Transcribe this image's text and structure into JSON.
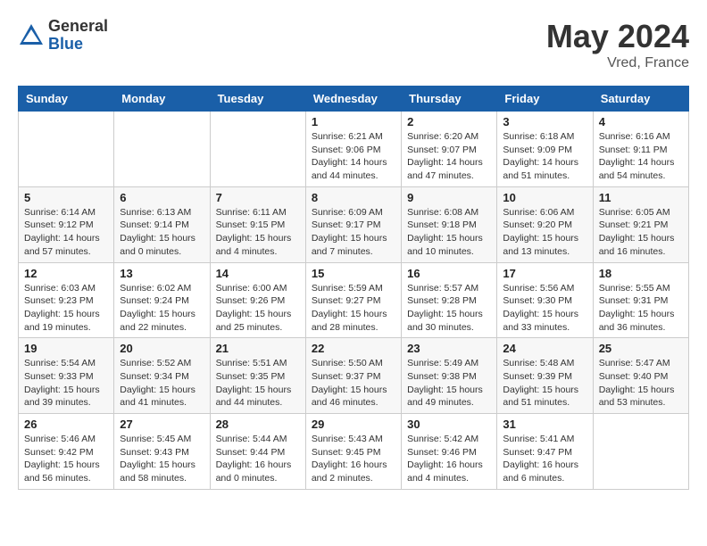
{
  "header": {
    "logo_general": "General",
    "logo_blue": "Blue",
    "month_year": "May 2024",
    "location": "Vred, France"
  },
  "weekdays": [
    "Sunday",
    "Monday",
    "Tuesday",
    "Wednesday",
    "Thursday",
    "Friday",
    "Saturday"
  ],
  "weeks": [
    [
      {
        "day": "",
        "sunrise": "",
        "sunset": "",
        "daylight": ""
      },
      {
        "day": "",
        "sunrise": "",
        "sunset": "",
        "daylight": ""
      },
      {
        "day": "",
        "sunrise": "",
        "sunset": "",
        "daylight": ""
      },
      {
        "day": "1",
        "sunrise": "Sunrise: 6:21 AM",
        "sunset": "Sunset: 9:06 PM",
        "daylight": "Daylight: 14 hours and 44 minutes."
      },
      {
        "day": "2",
        "sunrise": "Sunrise: 6:20 AM",
        "sunset": "Sunset: 9:07 PM",
        "daylight": "Daylight: 14 hours and 47 minutes."
      },
      {
        "day": "3",
        "sunrise": "Sunrise: 6:18 AM",
        "sunset": "Sunset: 9:09 PM",
        "daylight": "Daylight: 14 hours and 51 minutes."
      },
      {
        "day": "4",
        "sunrise": "Sunrise: 6:16 AM",
        "sunset": "Sunset: 9:11 PM",
        "daylight": "Daylight: 14 hours and 54 minutes."
      }
    ],
    [
      {
        "day": "5",
        "sunrise": "Sunrise: 6:14 AM",
        "sunset": "Sunset: 9:12 PM",
        "daylight": "Daylight: 14 hours and 57 minutes."
      },
      {
        "day": "6",
        "sunrise": "Sunrise: 6:13 AM",
        "sunset": "Sunset: 9:14 PM",
        "daylight": "Daylight: 15 hours and 0 minutes."
      },
      {
        "day": "7",
        "sunrise": "Sunrise: 6:11 AM",
        "sunset": "Sunset: 9:15 PM",
        "daylight": "Daylight: 15 hours and 4 minutes."
      },
      {
        "day": "8",
        "sunrise": "Sunrise: 6:09 AM",
        "sunset": "Sunset: 9:17 PM",
        "daylight": "Daylight: 15 hours and 7 minutes."
      },
      {
        "day": "9",
        "sunrise": "Sunrise: 6:08 AM",
        "sunset": "Sunset: 9:18 PM",
        "daylight": "Daylight: 15 hours and 10 minutes."
      },
      {
        "day": "10",
        "sunrise": "Sunrise: 6:06 AM",
        "sunset": "Sunset: 9:20 PM",
        "daylight": "Daylight: 15 hours and 13 minutes."
      },
      {
        "day": "11",
        "sunrise": "Sunrise: 6:05 AM",
        "sunset": "Sunset: 9:21 PM",
        "daylight": "Daylight: 15 hours and 16 minutes."
      }
    ],
    [
      {
        "day": "12",
        "sunrise": "Sunrise: 6:03 AM",
        "sunset": "Sunset: 9:23 PM",
        "daylight": "Daylight: 15 hours and 19 minutes."
      },
      {
        "day": "13",
        "sunrise": "Sunrise: 6:02 AM",
        "sunset": "Sunset: 9:24 PM",
        "daylight": "Daylight: 15 hours and 22 minutes."
      },
      {
        "day": "14",
        "sunrise": "Sunrise: 6:00 AM",
        "sunset": "Sunset: 9:26 PM",
        "daylight": "Daylight: 15 hours and 25 minutes."
      },
      {
        "day": "15",
        "sunrise": "Sunrise: 5:59 AM",
        "sunset": "Sunset: 9:27 PM",
        "daylight": "Daylight: 15 hours and 28 minutes."
      },
      {
        "day": "16",
        "sunrise": "Sunrise: 5:57 AM",
        "sunset": "Sunset: 9:28 PM",
        "daylight": "Daylight: 15 hours and 30 minutes."
      },
      {
        "day": "17",
        "sunrise": "Sunrise: 5:56 AM",
        "sunset": "Sunset: 9:30 PM",
        "daylight": "Daylight: 15 hours and 33 minutes."
      },
      {
        "day": "18",
        "sunrise": "Sunrise: 5:55 AM",
        "sunset": "Sunset: 9:31 PM",
        "daylight": "Daylight: 15 hours and 36 minutes."
      }
    ],
    [
      {
        "day": "19",
        "sunrise": "Sunrise: 5:54 AM",
        "sunset": "Sunset: 9:33 PM",
        "daylight": "Daylight: 15 hours and 39 minutes."
      },
      {
        "day": "20",
        "sunrise": "Sunrise: 5:52 AM",
        "sunset": "Sunset: 9:34 PM",
        "daylight": "Daylight: 15 hours and 41 minutes."
      },
      {
        "day": "21",
        "sunrise": "Sunrise: 5:51 AM",
        "sunset": "Sunset: 9:35 PM",
        "daylight": "Daylight: 15 hours and 44 minutes."
      },
      {
        "day": "22",
        "sunrise": "Sunrise: 5:50 AM",
        "sunset": "Sunset: 9:37 PM",
        "daylight": "Daylight: 15 hours and 46 minutes."
      },
      {
        "day": "23",
        "sunrise": "Sunrise: 5:49 AM",
        "sunset": "Sunset: 9:38 PM",
        "daylight": "Daylight: 15 hours and 49 minutes."
      },
      {
        "day": "24",
        "sunrise": "Sunrise: 5:48 AM",
        "sunset": "Sunset: 9:39 PM",
        "daylight": "Daylight: 15 hours and 51 minutes."
      },
      {
        "day": "25",
        "sunrise": "Sunrise: 5:47 AM",
        "sunset": "Sunset: 9:40 PM",
        "daylight": "Daylight: 15 hours and 53 minutes."
      }
    ],
    [
      {
        "day": "26",
        "sunrise": "Sunrise: 5:46 AM",
        "sunset": "Sunset: 9:42 PM",
        "daylight": "Daylight: 15 hours and 56 minutes."
      },
      {
        "day": "27",
        "sunrise": "Sunrise: 5:45 AM",
        "sunset": "Sunset: 9:43 PM",
        "daylight": "Daylight: 15 hours and 58 minutes."
      },
      {
        "day": "28",
        "sunrise": "Sunrise: 5:44 AM",
        "sunset": "Sunset: 9:44 PM",
        "daylight": "Daylight: 16 hours and 0 minutes."
      },
      {
        "day": "29",
        "sunrise": "Sunrise: 5:43 AM",
        "sunset": "Sunset: 9:45 PM",
        "daylight": "Daylight: 16 hours and 2 minutes."
      },
      {
        "day": "30",
        "sunrise": "Sunrise: 5:42 AM",
        "sunset": "Sunset: 9:46 PM",
        "daylight": "Daylight: 16 hours and 4 minutes."
      },
      {
        "day": "31",
        "sunrise": "Sunrise: 5:41 AM",
        "sunset": "Sunset: 9:47 PM",
        "daylight": "Daylight: 16 hours and 6 minutes."
      },
      {
        "day": "",
        "sunrise": "",
        "sunset": "",
        "daylight": ""
      }
    ]
  ]
}
